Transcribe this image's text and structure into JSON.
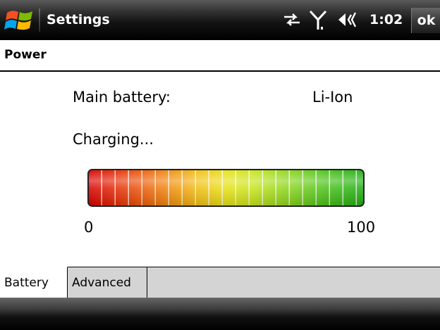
{
  "titlebar": {
    "app_title": "Settings",
    "start_icon": "windows-start-icon",
    "connectivity_icon": "connectivity-icon",
    "signal_icon": "signal-icon",
    "volume_icon": "volume-icon",
    "time": "1:02",
    "ok_label": "ok"
  },
  "page": {
    "section_title": "Power"
  },
  "battery": {
    "main_label": "Main battery:",
    "type": "Li-Ion",
    "status": "Charging...",
    "level_percent": 100,
    "min_label": "0",
    "max_label": "100"
  },
  "tabs": [
    {
      "label": "Battery",
      "active": true
    },
    {
      "label": "Advanced",
      "active": false
    }
  ],
  "colors": {
    "title_bar": "#000000",
    "bar_low": "#d80000",
    "bar_mid": "#e7e21a",
    "bar_high": "#1fae12",
    "tab_strip": "#d4d4d4"
  }
}
